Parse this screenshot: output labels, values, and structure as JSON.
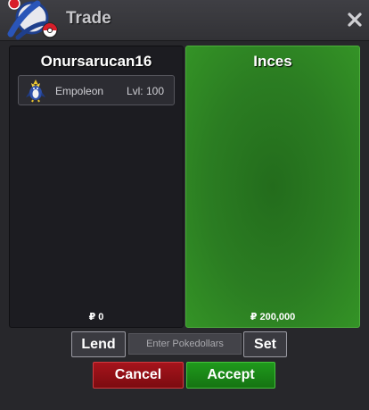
{
  "window": {
    "title": "Trade",
    "logo_icon": "pokeball-emblem",
    "close_icon": "close-x"
  },
  "left_panel": {
    "player_name": "Onursarucan16",
    "pokemon": {
      "name": "Empoleon",
      "level_text": "Lvl: 100",
      "sprite_icon": "empoleon-sprite"
    },
    "money": "₽ 0"
  },
  "right_panel": {
    "player_name": "Inces",
    "money": "₽ 200,000",
    "accent_color": "#2b7d22"
  },
  "controls": {
    "lend_label": "Lend",
    "pokedollar_placeholder": "Enter Pokedollars",
    "pokedollar_value": "",
    "set_label": "Set",
    "cancel_label": "Cancel",
    "accept_label": "Accept"
  },
  "colors": {
    "cancel": "#a6141c",
    "accept": "#1f9a1c",
    "window_bg": "#27272b"
  }
}
